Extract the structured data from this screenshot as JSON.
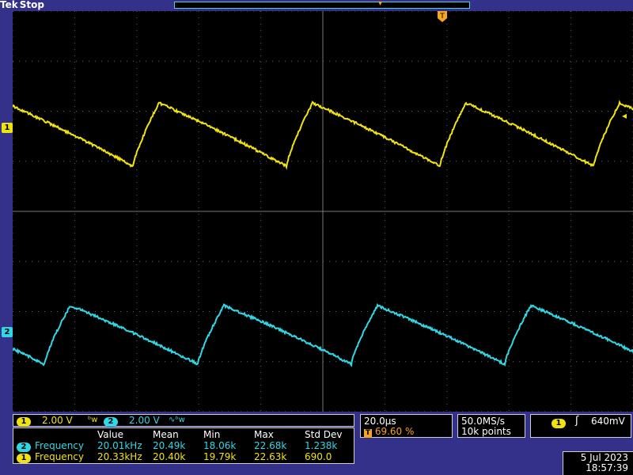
{
  "header": {
    "brand": "Tek",
    "state": "Stop"
  },
  "channels": {
    "ch1": {
      "num": "1",
      "scale": "2.00 V",
      "color": "#f1e40d",
      "coupling_icon": "bandwidth-limit-icon"
    },
    "ch2": {
      "num": "2",
      "scale": "2.00 V",
      "color": "#2fd8e4",
      "coupling_icon": "bandwidth-limit-icon"
    }
  },
  "timebase": {
    "scale": "20.0µs",
    "trigger_position": "69.60 %"
  },
  "sampling": {
    "rate": "50.0MS/s",
    "record_length": "10k points"
  },
  "trigger": {
    "source": "1",
    "slope_icon": "rising-edge-icon",
    "level": "640mV"
  },
  "measurements": {
    "headers": [
      "Value",
      "Mean",
      "Min",
      "Max",
      "Std Dev"
    ],
    "rows": [
      {
        "ch": "2",
        "name": "Frequency",
        "value": "20.01kHz",
        "mean": "20.49k",
        "min": "18.06k",
        "max": "22.68k",
        "stddev": "1.238k"
      },
      {
        "ch": "1",
        "name": "Frequency",
        "value": "20.33kHz",
        "mean": "20.40k",
        "min": "19.79k",
        "max": "22.63k",
        "stddev": "690.0"
      }
    ]
  },
  "datetime": {
    "date": "5 Jul  2023",
    "time": "18:57:39"
  },
  "markers": {
    "trigger_marker": "T",
    "ch1_marker": "1",
    "ch2_marker": "2",
    "trigger_level_arrow": "◂"
  }
}
